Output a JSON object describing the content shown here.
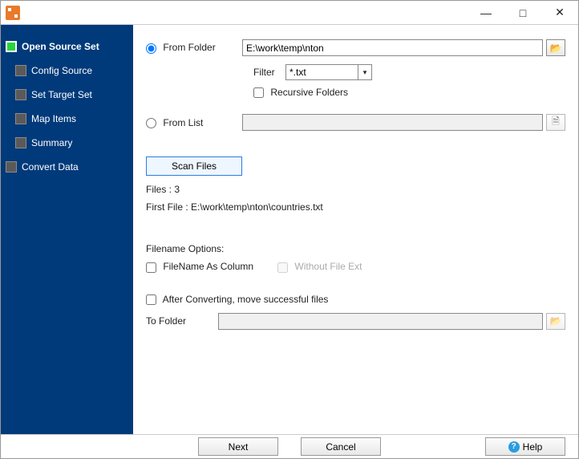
{
  "titlebar": {
    "title": ""
  },
  "sidebar": {
    "items": [
      {
        "label": "Open Source Set",
        "active": true
      },
      {
        "label": "Config Source"
      },
      {
        "label": "Set Target Set"
      },
      {
        "label": "Map Items"
      },
      {
        "label": "Summary"
      },
      {
        "label": "Convert Data"
      }
    ]
  },
  "main": {
    "fromFolder": {
      "radio": "From Folder",
      "path": "E:\\work\\temp\\nton"
    },
    "filter": {
      "label": "Filter",
      "value": "*.txt"
    },
    "recursive": "Recursive Folders",
    "fromList": {
      "radio": "From List",
      "path": ""
    },
    "scanBtn": "Scan Files",
    "filesCount": "Files : 3",
    "firstFile": "First File : E:\\work\\temp\\nton\\countries.txt",
    "filenameOptionsLabel": "Filename Options:",
    "filenameAsColumn": "FileName As Column",
    "withoutFileExt": "Without File Ext",
    "afterConverting": "After Converting, move successful files",
    "toFolderLabel": "To Folder",
    "toFolderPath": ""
  },
  "footer": {
    "next": "Next",
    "cancel": "Cancel",
    "help": "Help"
  }
}
